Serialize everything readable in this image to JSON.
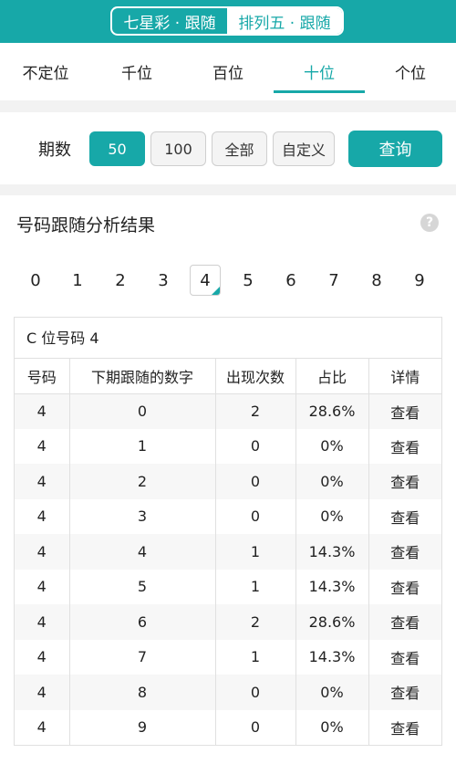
{
  "header": {
    "segments": [
      {
        "label": "七星彩 · 跟随",
        "active": false
      },
      {
        "label": "排列五 · 跟随",
        "active": true
      }
    ]
  },
  "position_tabs": [
    {
      "label": "不定位",
      "active": false
    },
    {
      "label": "千位",
      "active": false
    },
    {
      "label": "百位",
      "active": false
    },
    {
      "label": "十位",
      "active": true
    },
    {
      "label": "个位",
      "active": false
    }
  ],
  "period": {
    "label": "期数",
    "options": [
      {
        "label": "50",
        "selected": true
      },
      {
        "label": "100",
        "selected": false
      },
      {
        "label": "全部",
        "selected": false
      },
      {
        "label": "自定义",
        "selected": false
      }
    ],
    "query_label": "查询"
  },
  "result": {
    "title": "号码跟随分析结果",
    "help_icon": "question-icon",
    "digits": [
      "0",
      "1",
      "2",
      "3",
      "4",
      "5",
      "6",
      "7",
      "8",
      "9"
    ],
    "selected_digit": "4",
    "table_caption": "C 位号码 4",
    "columns": [
      "号码",
      "下期跟随的数字",
      "出现次数",
      "占比",
      "详情"
    ],
    "rows": [
      [
        "4",
        "0",
        "2",
        "28.6%",
        "查看"
      ],
      [
        "4",
        "1",
        "0",
        "0%",
        "查看"
      ],
      [
        "4",
        "2",
        "0",
        "0%",
        "查看"
      ],
      [
        "4",
        "3",
        "0",
        "0%",
        "查看"
      ],
      [
        "4",
        "4",
        "1",
        "14.3%",
        "查看"
      ],
      [
        "4",
        "5",
        "1",
        "14.3%",
        "查看"
      ],
      [
        "4",
        "6",
        "2",
        "28.6%",
        "查看"
      ],
      [
        "4",
        "7",
        "1",
        "14.3%",
        "查看"
      ],
      [
        "4",
        "8",
        "0",
        "0%",
        "查看"
      ],
      [
        "4",
        "9",
        "0",
        "0%",
        "查看"
      ]
    ]
  },
  "colors": {
    "accent": "#17a8a8"
  }
}
